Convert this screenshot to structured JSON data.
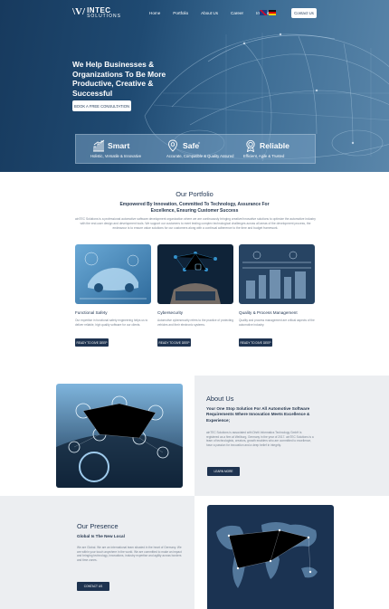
{
  "header": {
    "logo_mark": "\\V/",
    "logo_name": "INTEC",
    "logo_tagline": "SOLUTIONS",
    "nav": [
      "Home",
      "Portfolio",
      "About Us",
      "Career",
      "Imprint"
    ],
    "contact_label": "Contact Us"
  },
  "hero": {
    "headline": "We Help Businesses & Organizations To Be More Productive, Creative & Successful",
    "cta_label": "BOOK A FREE CONSULTATION"
  },
  "features": [
    {
      "title": "Smart",
      "subtitle": "Holistic, Versatile & Innovative",
      "icon": "chart-icon"
    },
    {
      "title": "Safe",
      "subtitle": "Accurate, Compatible & Quality Assured",
      "icon": "location-shield-icon"
    },
    {
      "title": "Reliable",
      "subtitle": "Efficient, Agile & Trusted",
      "icon": "award-icon"
    }
  ],
  "portfolio": {
    "title": "Our Portfolio",
    "subtitle": "Empowered By Innovation, Committed To Technology, Assurance For Excellence, Ensuring Customer Success",
    "description": "ainTEC Solutions is a professional automotive software development organization where we are continuously bringing creative/innovative solutions to optimize the automotive industry with the end-user design and development tools. We support our customers to meet testing complex technological challenges across all areas of the development process, the endeavour is to ensure value solutions for our customers along with a continual adherence to the time and budget framework.",
    "cards": [
      {
        "title": "Functional Safety",
        "description": "Our expertise in functional safety engineering helps us to deliver reliable, high quality software for our clients.",
        "button": "READY TO DIVE DEEP"
      },
      {
        "title": "Cybersecurity",
        "description": "Automotive cybersecurity refers to the practice of protecting vehicles and their electronic systems.",
        "button": "READY TO DIVE DEEP"
      },
      {
        "title": "Quality & Process Management",
        "description": "Quality and process management are critical aspects of the automotive industry.",
        "button": "READY TO DIVE DEEP"
      }
    ]
  },
  "about": {
    "title": "About Us",
    "subtitle": "Your One Stop Solution For All Automotive Software Requirements Where Innovation Meets Excellence & Experience;",
    "description": "ainTEC Solutions is associated with Dhriti Informatics Technology GmbH is registered as a firm at Weilburg, Germany in the year of 2017. ainTEC Solutions is a team of technologists, creators, growth enablers who are committed to excellence, have a passion for innovation and a deep belief in integrity.",
    "button": "LEARN MORE"
  },
  "presence": {
    "title": "Our Presence",
    "subtitle": "Global Is The New Local",
    "description": "We are Global. We are an international team situated in the heart of Germany. We are within your touch anywhere in the world. We are committed to make an impact and bringing technology, innovations, industry expertise and agility across borders and time zones.",
    "button": "CONTACT US"
  }
}
